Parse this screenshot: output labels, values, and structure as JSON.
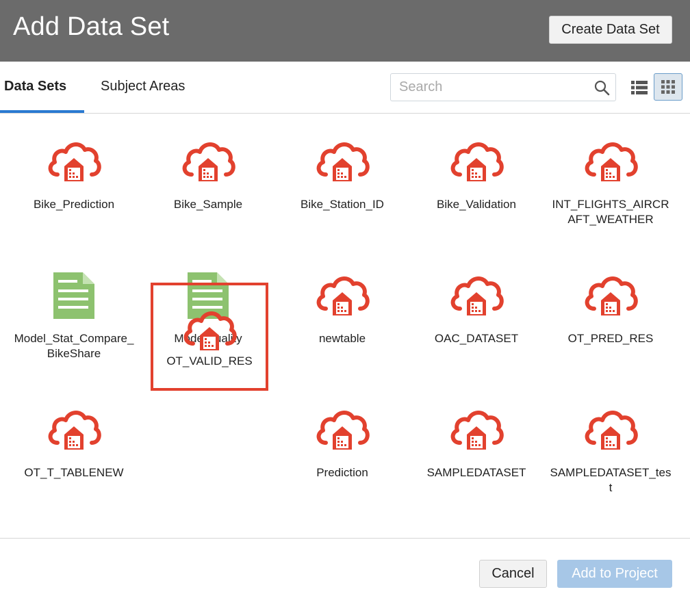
{
  "dialog": {
    "title": "Add Data Set",
    "create_button": "Create Data Set"
  },
  "tabs": [
    {
      "label": "Data Sets",
      "active": true
    },
    {
      "label": "Subject Areas",
      "active": false
    }
  ],
  "search": {
    "placeholder": "Search",
    "value": ""
  },
  "view_toggle": {
    "list_icon": "list-view-icon",
    "grid_icon": "grid-view-icon",
    "active": "grid"
  },
  "colors": {
    "header": "#6b6b6b",
    "accent": "#2a7ad1",
    "cloud_icon": "#e2412e",
    "document_icon": "#8dc26f",
    "selection": "#e2412e"
  },
  "datasets": [
    {
      "label": "Bike_Prediction",
      "icon": "cloud-warehouse-icon"
    },
    {
      "label": "Bike_Sample",
      "icon": "cloud-warehouse-icon"
    },
    {
      "label": "Bike_Station_ID",
      "icon": "cloud-warehouse-icon"
    },
    {
      "label": "Bike_Validation",
      "icon": "cloud-warehouse-icon"
    },
    {
      "label": "INT_FLIGHTS_AIRCRAFT_WEATHER",
      "icon": "cloud-warehouse-icon"
    },
    {
      "label": "Model_Stat_Compare_BikeShare",
      "icon": "document-icon"
    },
    {
      "label": "ModelQuality",
      "icon": "document-icon"
    },
    {
      "label": "newtable",
      "icon": "cloud-warehouse-icon"
    },
    {
      "label": "OAC_DATASET",
      "icon": "cloud-warehouse-icon"
    },
    {
      "label": "OT_PRED_RES",
      "icon": "cloud-warehouse-icon"
    },
    {
      "label": "OT_T_TABLENEW",
      "icon": "cloud-warehouse-icon"
    },
    {
      "label": "OT_VALID_RES",
      "icon": "cloud-warehouse-icon",
      "selected": true
    },
    {
      "label": "Prediction",
      "icon": "cloud-warehouse-icon"
    },
    {
      "label": "SAMPLEDATASET",
      "icon": "cloud-warehouse-icon"
    },
    {
      "label": "SAMPLEDATASET_test",
      "icon": "cloud-warehouse-icon"
    }
  ],
  "footer": {
    "cancel_button": "Cancel",
    "add_button": "Add to Project",
    "add_enabled": false
  }
}
